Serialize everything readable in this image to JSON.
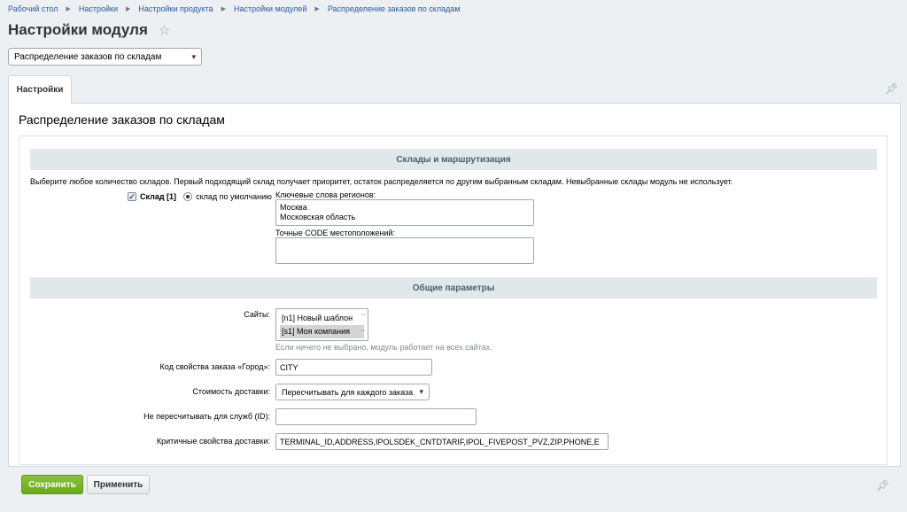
{
  "breadcrumb": [
    "Рабочий стол",
    "Настройки",
    "Настройки продукта",
    "Настройки модулей",
    "Распределение заказов по складам"
  ],
  "page_title": "Настройки модуля",
  "module_select": {
    "value": "Распределение заказов по складам"
  },
  "tabs": [
    {
      "label": "Настройки"
    }
  ],
  "panel_title": "Распределение заказов по складам",
  "section1": {
    "title": "Склады и маршрутизация",
    "description": "Выберите любое количество складов. Первый подходящий склад получает приоритет, остаток распределяется по другим выбранным складам. Невыбранные склады модуль не использует.",
    "warehouse_label": "Склад [1]",
    "warehouse_checked": true,
    "default_label": "склад по умолчанию",
    "keywords_label": "Ключевые слова регионов:",
    "keywords_value": "Москва\nМосковская область",
    "codes_label": "Точные CODE местоположений:",
    "codes_value": ""
  },
  "section2": {
    "title": "Общие параметры",
    "sites_label": "Сайты:",
    "sites_options": [
      {
        "label": "[n1] Новый шаблон",
        "selected": false
      },
      {
        "label": "[s1] Моя компания",
        "selected": true
      }
    ],
    "sites_hint": "Если ничего не выбрано, модуль работает на всех сайтах.",
    "city_label": "Код свойства заказа «Город»:",
    "city_value": "CITY",
    "delivery_label": "Стоимость доставки:",
    "delivery_value": "Пересчитывать для каждого заказа",
    "no_recalc_label": "Не пересчитывать для служб (ID):",
    "no_recalc_value": "",
    "critical_label": "Критичные свойства доставки:",
    "critical_value": "TERMINAL_ID,ADDRESS,IPOLSDEK_CNTDTARIF,IPOL_FIVEPOST_PVZ,ZIP,PHONE,E"
  },
  "buttons": {
    "save": "Сохранить",
    "apply": "Применить"
  },
  "icons": {
    "star": "star-icon",
    "pin": "pin-icon",
    "chevron": "chevron-down-icon"
  },
  "colors": {
    "save_button": "#77b22a",
    "section_head_bg": "#e0e8ea",
    "page_bg": "#edf0f3"
  }
}
